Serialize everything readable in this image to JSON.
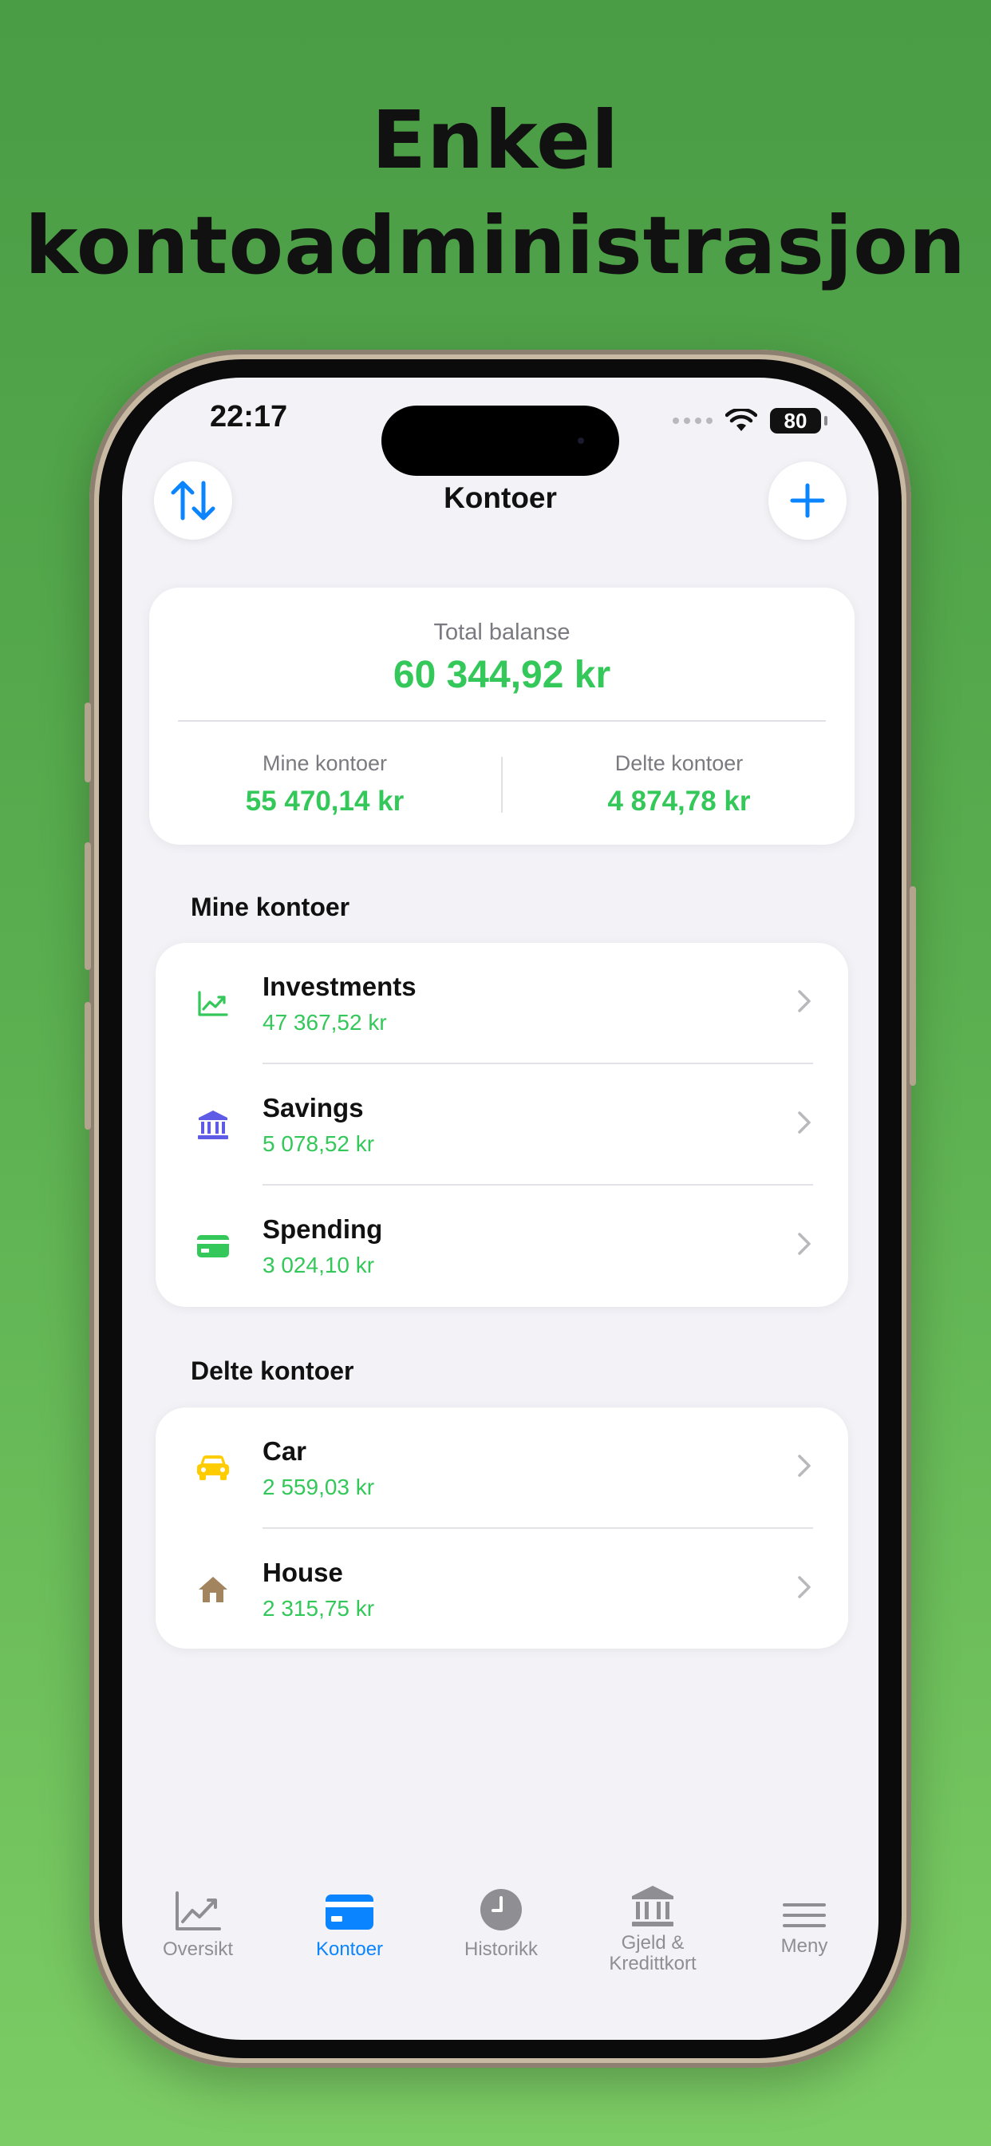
{
  "headline": {
    "line1": "Enkel",
    "line2": "kontoadministrasjon"
  },
  "status_bar": {
    "time": "22:17",
    "battery": "80"
  },
  "nav": {
    "title": "Kontoer",
    "sort_icon": "sort-arrows-icon",
    "add_icon": "plus-icon"
  },
  "summary": {
    "total_label": "Total balanse",
    "total_value": "60 344,92 kr",
    "mine_label": "Mine kontoer",
    "mine_value": "55 470,14 kr",
    "shared_label": "Delte kontoer",
    "shared_value": "4 874,78 kr"
  },
  "sections": {
    "mine_title": "Mine kontoer",
    "shared_title": "Delte kontoer"
  },
  "mine_accounts": [
    {
      "name": "Investments",
      "amount": "47 367,52 kr",
      "icon": "chart-up-icon"
    },
    {
      "name": "Savings",
      "amount": "5 078,52 kr",
      "icon": "bank-icon"
    },
    {
      "name": "Spending",
      "amount": "3 024,10 kr",
      "icon": "credit-card-icon"
    }
  ],
  "shared_accounts": [
    {
      "name": "Car",
      "amount": "2 559,03 kr",
      "icon": "car-icon"
    },
    {
      "name": "House",
      "amount": "2 315,75 kr",
      "icon": "house-icon"
    }
  ],
  "tabs": [
    {
      "label": "Oversikt",
      "icon": "chart-icon"
    },
    {
      "label": "Kontoer",
      "icon": "card-icon",
      "active": true
    },
    {
      "label": "Historikk",
      "icon": "clock-icon"
    },
    {
      "label": "Gjeld &\nKredittkort",
      "icon": "bank-icon"
    },
    {
      "label": "Meny",
      "icon": "menu-icon"
    }
  ],
  "colors": {
    "accent": "#0a84ff",
    "positive": "#34c759",
    "savings": "#5e5ce6",
    "car": "#ffcc00",
    "house": "#a2845e"
  }
}
